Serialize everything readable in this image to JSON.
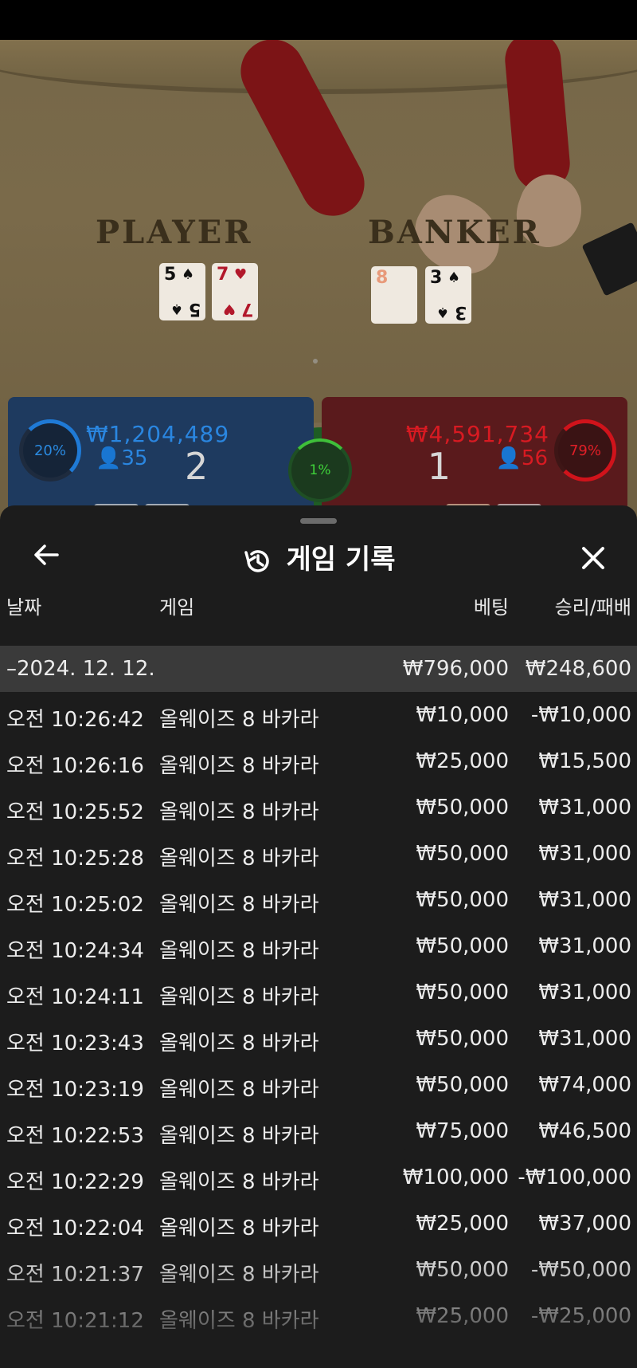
{
  "video": {
    "player_label": "PLAYER",
    "banker_label": "BANKER",
    "player_cards": [
      {
        "rank": "5",
        "suit": "♠",
        "color": "blk"
      },
      {
        "rank": "7",
        "suit": "♥",
        "color": "red"
      }
    ],
    "banker_cards": [
      {
        "rank": "8",
        "suit": "",
        "color": "red"
      },
      {
        "rank": "3",
        "suit": "♠",
        "color": "blk"
      }
    ]
  },
  "bets": {
    "player": {
      "percent": "20%",
      "amount": "₩1,204,489",
      "count": "35",
      "score": "2"
    },
    "tie": {
      "percent": "1%"
    },
    "banker": {
      "percent": "79%",
      "amount": "₩4,591,734",
      "count": "56",
      "score": "1"
    }
  },
  "sheet": {
    "title": "게임 기록",
    "icons": {
      "back": "arrow-left-icon",
      "history": "history-icon",
      "close": "close-icon"
    },
    "columns": {
      "date": "날짜",
      "game": "게임",
      "bet": "베팅",
      "result": "승리/패배"
    },
    "summary": {
      "date": "–2024. 12. 12.",
      "bet": "₩796,000",
      "result": "₩248,600"
    },
    "rows": [
      {
        "time": "오전 10:26:42",
        "game": "올웨이즈 8 바카라",
        "bet": "₩10,000",
        "result": "-₩10,000"
      },
      {
        "time": "오전 10:26:16",
        "game": "올웨이즈 8 바카라",
        "bet": "₩25,000",
        "result": "₩15,500"
      },
      {
        "time": "오전 10:25:52",
        "game": "올웨이즈 8 바카라",
        "bet": "₩50,000",
        "result": "₩31,000"
      },
      {
        "time": "오전 10:25:28",
        "game": "올웨이즈 8 바카라",
        "bet": "₩50,000",
        "result": "₩31,000"
      },
      {
        "time": "오전 10:25:02",
        "game": "올웨이즈 8 바카라",
        "bet": "₩50,000",
        "result": "₩31,000"
      },
      {
        "time": "오전 10:24:34",
        "game": "올웨이즈 8 바카라",
        "bet": "₩50,000",
        "result": "₩31,000"
      },
      {
        "time": "오전 10:24:11",
        "game": "올웨이즈 8 바카라",
        "bet": "₩50,000",
        "result": "₩31,000"
      },
      {
        "time": "오전 10:23:43",
        "game": "올웨이즈 8 바카라",
        "bet": "₩50,000",
        "result": "₩31,000"
      },
      {
        "time": "오전 10:23:19",
        "game": "올웨이즈 8 바카라",
        "bet": "₩50,000",
        "result": "₩74,000"
      },
      {
        "time": "오전 10:22:53",
        "game": "올웨이즈 8 바카라",
        "bet": "₩75,000",
        "result": "₩46,500"
      },
      {
        "time": "오전 10:22:29",
        "game": "올웨이즈 8 바카라",
        "bet": "₩100,000",
        "result": "-₩100,000"
      },
      {
        "time": "오전 10:22:04",
        "game": "올웨이즈 8 바카라",
        "bet": "₩25,000",
        "result": "₩37,000"
      },
      {
        "time": "오전 10:21:37",
        "game": "올웨이즈 8 바카라",
        "bet": "₩50,000",
        "result": "-₩50,000"
      },
      {
        "time": "오전 10:21:12",
        "game": "올웨이즈 8 바카라",
        "bet": "₩25,000",
        "result": "-₩25,000"
      }
    ]
  }
}
